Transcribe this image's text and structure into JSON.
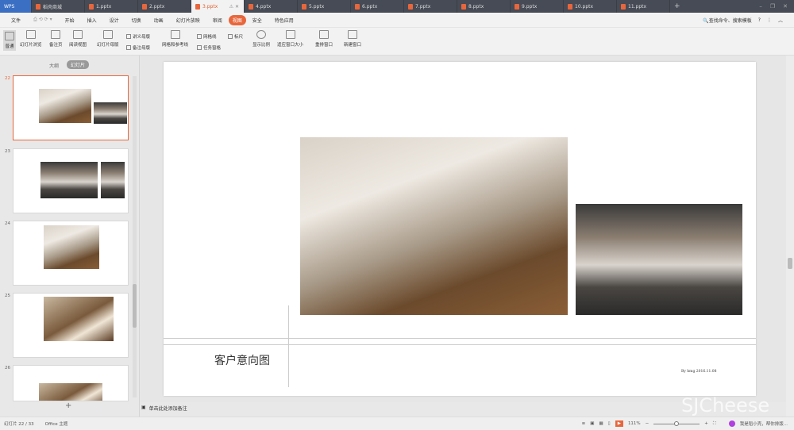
{
  "app": {
    "logo": "WPS"
  },
  "tabs": [
    {
      "label": "稻壳商城"
    },
    {
      "label": "1.pptx"
    },
    {
      "label": "2.pptx"
    },
    {
      "label": "3.pptx",
      "active": true
    },
    {
      "label": "4.pptx"
    },
    {
      "label": "5.pptx"
    },
    {
      "label": "6.pptx"
    },
    {
      "label": "7.pptx"
    },
    {
      "label": "8.pptx"
    },
    {
      "label": "9.pptx"
    },
    {
      "label": "10.pptx"
    },
    {
      "label": "11.pptx"
    }
  ],
  "menu": {
    "file": "文件",
    "items": [
      "开始",
      "插入",
      "设计",
      "切换",
      "动画",
      "幻灯片放映",
      "审阅",
      "视图",
      "安全",
      "特色应用"
    ],
    "active": "视图",
    "search": "查找命令、搜索模板"
  },
  "ribbon": {
    "normal": "普通",
    "sorter": "幻灯片浏览",
    "notes_page": "备注页",
    "reading": "阅读视图",
    "slide_master": "幻灯片母版",
    "handout_master": "讲义母版",
    "notes_master": "备注母版",
    "grid_guides": "网格和参考线",
    "gridlines": "网格线",
    "ruler": "标尺",
    "task_pane": "任务窗格",
    "zoom": "显示比例",
    "fit_window": "适应窗口大小",
    "arrange": "重排窗口",
    "new_window": "新建窗口"
  },
  "panel": {
    "outline_tab": "大纲",
    "slides_tab": "幻灯片",
    "slide_numbers": [
      "22",
      "23",
      "24",
      "25",
      "26"
    ]
  },
  "slide": {
    "title": "客户意向图",
    "byline": "By hmg 2016.11.08"
  },
  "notes": {
    "placeholder": "单击此处添加备注"
  },
  "status": {
    "slide_counter": "幻灯片 22 / 33",
    "theme": "Office 主题",
    "zoom": "111%",
    "assistant": "我是稻小壳，帮你排版..."
  },
  "watermark": "SJCheese",
  "colors": {
    "accent": "#e8663c",
    "tabbar": "#464b55"
  }
}
